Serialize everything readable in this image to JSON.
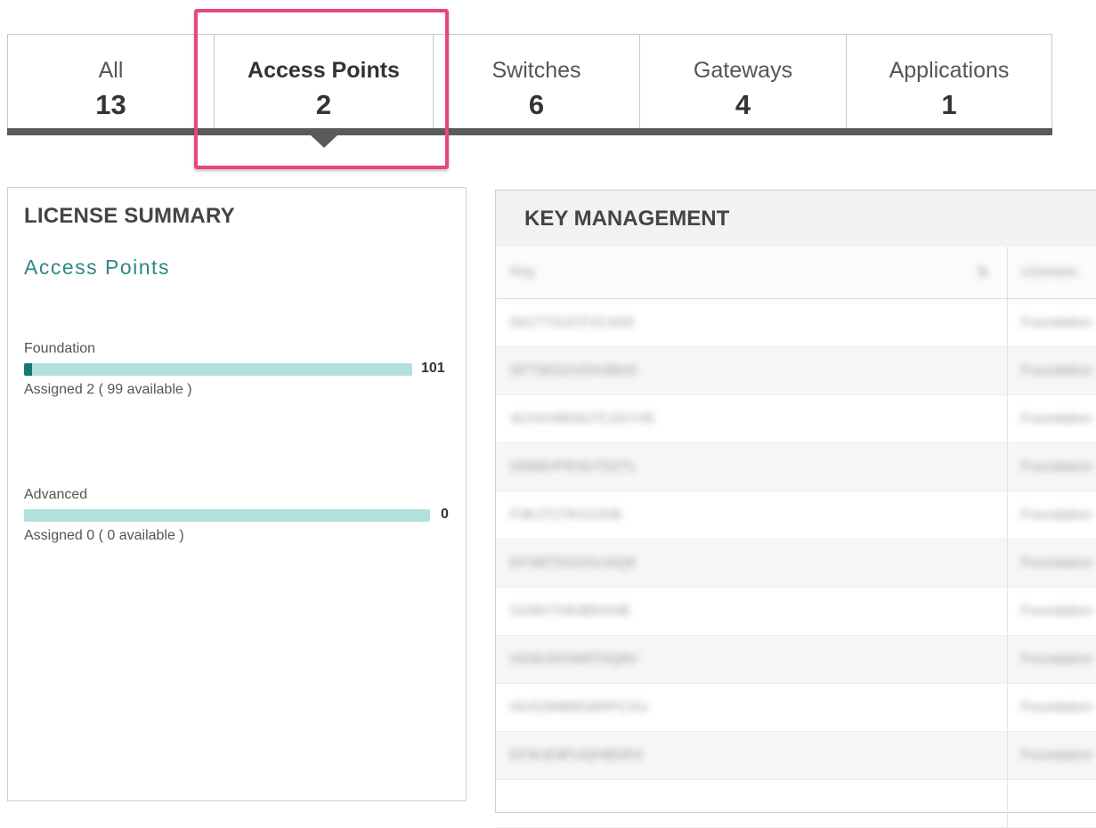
{
  "tabs": [
    {
      "label": "All",
      "count": "13",
      "active": false
    },
    {
      "label": "Access Points",
      "count": "2",
      "active": true
    },
    {
      "label": "Switches",
      "count": "6",
      "active": false
    },
    {
      "label": "Gateways",
      "count": "4",
      "active": false
    },
    {
      "label": "Applications",
      "count": "1",
      "active": false
    }
  ],
  "license_summary": {
    "title": "LICENSE SUMMARY",
    "subtitle": "Access Points",
    "licenses": [
      {
        "name": "Foundation",
        "total": "101",
        "assigned_text": "Assigned 2 ( 99 available )",
        "assigned_fraction": 0.02
      },
      {
        "name": "Advanced",
        "total": "0",
        "assigned_text": "Assigned 0 ( 0 available )",
        "assigned_fraction": 0.0
      }
    ]
  },
  "key_management": {
    "title": "KEY MANAGEMENT",
    "columns": [
      "Key",
      "Licenses"
    ],
    "rows": [
      {
        "key": "0A1T7G2CF2C4A9",
        "license": "Foundation"
      },
      {
        "key": "SFT5ED2VDH3BA5",
        "license": "Foundation"
      },
      {
        "key": "4CHVH8D8J7C2GY45",
        "license": "Foundation"
      },
      {
        "key": "D5B8VPR3G7D2TL",
        "license": "Foundation"
      },
      {
        "key": "F3K2T27KV2JH8",
        "license": "Foundation"
      },
      {
        "key": "EFSBT5GDGUAQ8",
        "license": "Foundation"
      },
      {
        "key": "GG8V7H8JB5XHB",
        "license": "Foundation"
      },
      {
        "key": "HG8UDGW8TAQ8V",
        "license": "Foundation"
      },
      {
        "key": "HUGSM88G8RPCXU",
        "license": "Foundation"
      },
      {
        "key": "EF9UE8FUQHBDR4",
        "license": "Foundation"
      },
      {
        "key": "",
        "license": ""
      }
    ]
  },
  "colors": {
    "accent_teal": "#2b8a83",
    "bar_track": "#b2e0dc",
    "bar_fill": "#167a6f",
    "highlight": "#e8457f",
    "tab_bar": "#5a5a5a"
  }
}
